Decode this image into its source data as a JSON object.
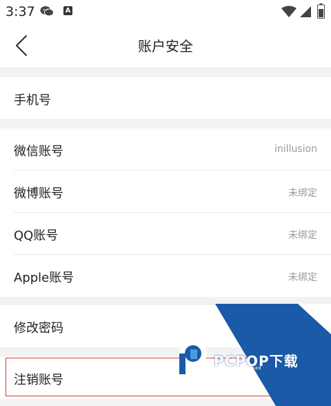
{
  "status_bar": {
    "time": "3:37",
    "notification_badge": "A",
    "icons": [
      "wechat-icon",
      "wifi-icon",
      "signal-icon",
      "battery-icon"
    ]
  },
  "header": {
    "title": "账户安全",
    "back_icon": "chevron-left-icon"
  },
  "sections": {
    "phone": {
      "label": "手机号"
    },
    "accounts": [
      {
        "label": "微信账号",
        "value": "inillusion"
      },
      {
        "label": "微博账号",
        "value": "未绑定"
      },
      {
        "label": "QQ账号",
        "value": "未绑定"
      },
      {
        "label": "Apple账号",
        "value": "未绑定"
      }
    ],
    "change_password": {
      "label": "修改密码"
    },
    "deactivate": {
      "label": "注销账号"
    }
  },
  "watermark": {
    "brand": "PCPOP下载",
    "sub": "PCPOP Download"
  },
  "colors": {
    "highlight": "#e0332a",
    "watermark_blue": "#1a5aa8",
    "secondary_text": "#9a9a9a",
    "background": "#f2f2f2"
  }
}
